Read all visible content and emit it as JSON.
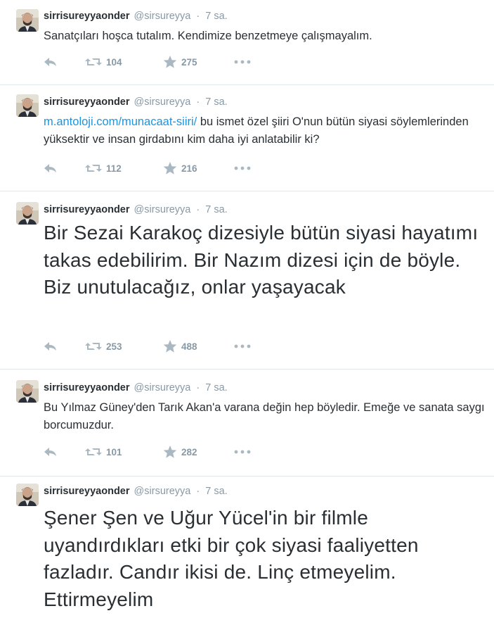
{
  "colors": {
    "link": "#1b95e0",
    "meta": "#8899a6",
    "text": "#292f33",
    "divider": "#e1e8ed"
  },
  "icons": {
    "reply": "reply-arrow-icon",
    "retweet": "retweet-icon",
    "favorite": "star-icon",
    "more": "ellipsis-icon"
  },
  "tweets": [
    {
      "fullname": "sirrisureyyaonder",
      "username": "@sirsureyya",
      "separator": "·",
      "time": "7 sa.",
      "link": "",
      "text": "Sanatçıları hoşca tutalım. Kendimize benzetmeye çalışmayalım.",
      "retweets": "104",
      "favorites": "275"
    },
    {
      "fullname": "sirrisureyyaonder",
      "username": "@sirsureyya",
      "separator": "·",
      "time": "7 sa.",
      "link": "m.antoloji.com/munacaat-siiri/",
      "text": " bu ismet özel şiiri O'nun bütün  siyasi söylemlerinden yüksektir ve insan girdabını kim daha iyi anlatabilir ki?",
      "retweets": "112",
      "favorites": "216"
    },
    {
      "fullname": "sirrisureyyaonder",
      "username": "@sirsureyya",
      "separator": "·",
      "time": "7 sa.",
      "link": "",
      "text": "Bir Sezai Karakoç dizesiyle bütün siyasi hayatımı takas edebilirim. Bir Nazım dizesi için de böyle. Biz unutulacağız, onlar yaşayacak",
      "retweets": "253",
      "favorites": "488"
    },
    {
      "fullname": "sirrisureyyaonder",
      "username": "@sirsureyya",
      "separator": "·",
      "time": "7 sa.",
      "link": "",
      "text": "Bu Yılmaz Güney'den Tarık Akan'a varana değin hep böyledir. Emeğe ve sanata saygı borcumuzdur.",
      "retweets": "101",
      "favorites": "282"
    },
    {
      "fullname": "sirrisureyyaonder",
      "username": "@sirsureyya",
      "separator": "·",
      "time": "7 sa.",
      "link": "",
      "text": "Şener Şen ve Uğur Yücel'in bir filmle uyandırdıkları etki bir çok siyasi faaliyetten fazladır. Candır ikisi de. Linç etmeyelim. Ettirmeyelim",
      "retweets": "",
      "favorites": ""
    }
  ]
}
